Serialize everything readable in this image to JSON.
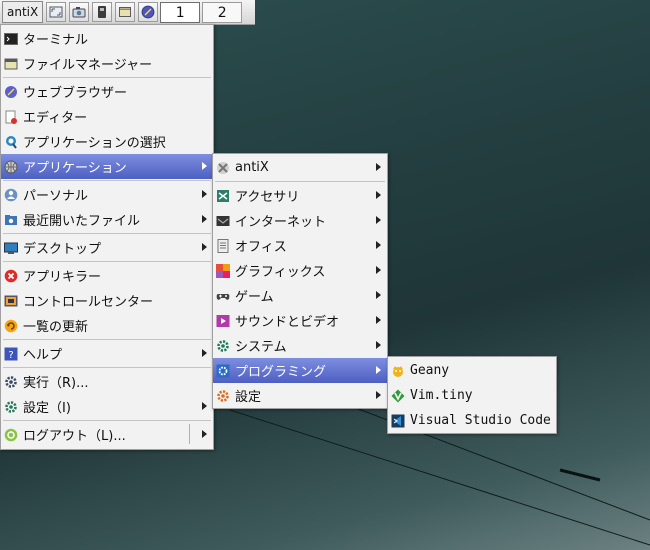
{
  "taskbar": {
    "start_label": "antiX",
    "launchers": [
      "show-desktop-icon",
      "screenshot-icon",
      "usb-icon",
      "file-manager-icon",
      "browser-icon"
    ],
    "desktops": [
      "1",
      "2"
    ],
    "active_desktop": "1"
  },
  "main_menu": {
    "items": [
      {
        "label": "ターミナル",
        "icon": "terminal-icon"
      },
      {
        "label": "ファイルマネージャー",
        "icon": "file-manager-icon"
      },
      {
        "label": "ウェブブラウザー",
        "icon": "browser-icon"
      },
      {
        "label": "エディター",
        "icon": "editor-icon"
      },
      {
        "label": "アプリケーションの選択",
        "icon": "app-select-icon"
      },
      {
        "label": "アプリケーション",
        "icon": "applications-icon"
      },
      {
        "label": "パーソナル",
        "icon": "personal-icon"
      },
      {
        "label": "最近開いたファイル",
        "icon": "recent-files-icon"
      },
      {
        "label": "デスクトップ",
        "icon": "desktop-icon"
      },
      {
        "label": "アプリキラー",
        "icon": "app-killer-icon"
      },
      {
        "label": "コントロールセンター",
        "icon": "control-centre-icon"
      },
      {
        "label": "一覧の更新",
        "icon": "refresh-icon"
      },
      {
        "label": "ヘルプ",
        "icon": "help-icon"
      },
      {
        "label": "実行（R)...",
        "icon": "run-icon"
      },
      {
        "label": "設定（I)",
        "icon": "settings-icon"
      },
      {
        "label": "ログアウト（L)...",
        "icon": "logout-icon"
      }
    ]
  },
  "applications_menu": {
    "items": [
      {
        "label": "antiX",
        "icon": "antix-icon"
      },
      {
        "label": "アクセサリ",
        "icon": "accessories-icon"
      },
      {
        "label": "インターネット",
        "icon": "internet-icon"
      },
      {
        "label": "オフィス",
        "icon": "office-icon"
      },
      {
        "label": "グラフィックス",
        "icon": "graphics-icon"
      },
      {
        "label": "ゲーム",
        "icon": "games-icon"
      },
      {
        "label": "サウンドとビデオ",
        "icon": "sound-video-icon"
      },
      {
        "label": "システム",
        "icon": "system-icon"
      },
      {
        "label": "プログラミング",
        "icon": "programming-icon"
      },
      {
        "label": "設定",
        "icon": "settings-icon"
      }
    ]
  },
  "programming_menu": {
    "items": [
      {
        "label": "Geany",
        "icon": "geany-icon"
      },
      {
        "label": "Vim.tiny",
        "icon": "vim-icon"
      },
      {
        "label": "Visual Studio Code",
        "icon": "vscode-icon"
      }
    ]
  },
  "colors": {
    "selection_top": "#7e8ee0",
    "selection_bottom": "#4d5fc2",
    "menu_bg": "#f2f2f2"
  }
}
